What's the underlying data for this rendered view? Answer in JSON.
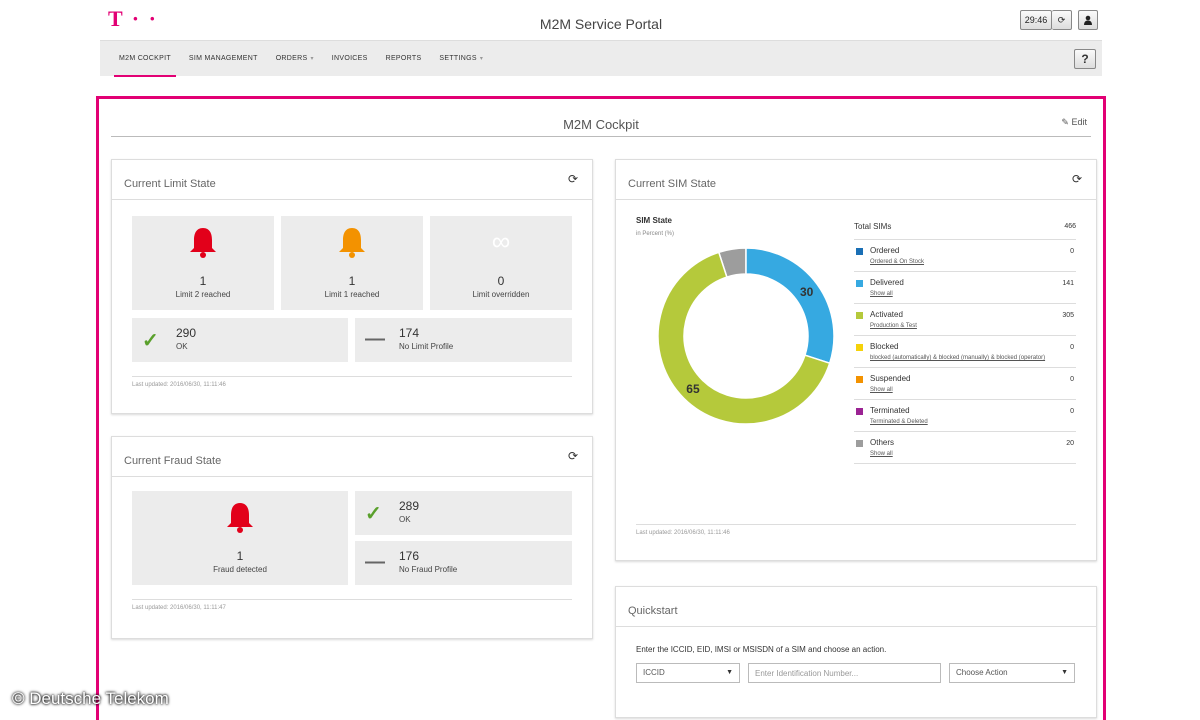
{
  "header": {
    "logo": "T · ·",
    "title": "M2M Service Portal",
    "time": "29:46"
  },
  "nav": {
    "items": [
      "M2M COCKPIT",
      "SIM MANAGEMENT",
      "ORDERS",
      "INVOICES",
      "REPORTS",
      "SETTINGS"
    ],
    "help": "?"
  },
  "cockpit": {
    "title": "M2M Cockpit",
    "edit": "Edit"
  },
  "limit_state": {
    "title": "Current Limit State",
    "limit2": {
      "value": "1",
      "label": "Limit 2 reached"
    },
    "limit1": {
      "value": "1",
      "label": "Limit 1 reached"
    },
    "overridden": {
      "value": "0",
      "label": "Limit overridden"
    },
    "ok": {
      "value": "290",
      "label": "OK"
    },
    "no_profile": {
      "value": "174",
      "label": "No Limit Profile"
    },
    "updated": "Last updated: 2016/06/30, 11:11:46"
  },
  "fraud_state": {
    "title": "Current Fraud State",
    "detected": {
      "value": "1",
      "label": "Fraud detected"
    },
    "ok": {
      "value": "289",
      "label": "OK"
    },
    "no_profile": {
      "value": "176",
      "label": "No Fraud Profile"
    },
    "updated": "Last updated: 2016/06/30, 11:11:47"
  },
  "sim_state": {
    "title": "Current SIM State",
    "chart_title": "SIM State",
    "chart_subtitle": "in Percent (%)",
    "updated": "Last updated: 2016/06/30, 11:11:46",
    "total_label": "Total SIMs",
    "total_value": "466",
    "legend": [
      {
        "name": "Ordered",
        "value": "0",
        "color": "#1a6fb5",
        "links": "Ordered & On Stock"
      },
      {
        "name": "Delivered",
        "value": "141",
        "color": "#36a9e1",
        "links": "Show all"
      },
      {
        "name": "Activated",
        "value": "305",
        "color": "#b5c93b",
        "links": "Production & Test"
      },
      {
        "name": "Blocked",
        "value": "0",
        "color": "#f5d20a",
        "links": "blocked (automatically) & blocked (manually) & blocked (operator)"
      },
      {
        "name": "Suspended",
        "value": "0",
        "color": "#f39200",
        "links": "Show all"
      },
      {
        "name": "Terminated",
        "value": "0",
        "color": "#9b2393",
        "links": "Terminated & Deleted"
      },
      {
        "name": "Others",
        "value": "20",
        "color": "#9d9d9d",
        "links": "Show all"
      }
    ]
  },
  "chart_data": {
    "type": "pie",
    "title": "SIM State",
    "subtitle": "in Percent (%)",
    "categories": [
      "Delivered",
      "Activated",
      "Others"
    ],
    "values": [
      30,
      65,
      5
    ],
    "data_labels": [
      "30",
      "65",
      ""
    ],
    "colors": [
      "#36a9e1",
      "#b5c93b",
      "#9d9d9d"
    ],
    "donut": true
  },
  "quickstart": {
    "title": "Quickstart",
    "instruction": "Enter the ICCID, EID, IMSI or MSISDN of a SIM and choose an action.",
    "id_type": "ICCID",
    "placeholder": "Enter Identification Number...",
    "action": "Choose Action"
  },
  "copyright": "© Deutsche Telekom"
}
